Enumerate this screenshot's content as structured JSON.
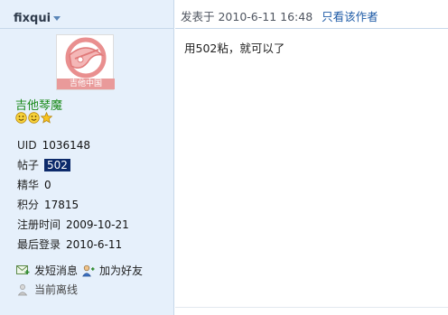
{
  "author": {
    "name": "fixqui",
    "avatar_caption": "吉他中国",
    "rank_title": "吉他琴魔",
    "badges": [
      "smile-icon",
      "smile-icon",
      "star-icon"
    ],
    "stats": [
      {
        "key": "UID",
        "value": "1036148"
      },
      {
        "key": "帖子",
        "value": "502"
      },
      {
        "key": "精华",
        "value": "0"
      },
      {
        "key": "积分",
        "value": "17815"
      },
      {
        "key": "注册时间",
        "value": "2009-10-21"
      },
      {
        "key": "最后登录",
        "value": "2010-6-11"
      }
    ],
    "actions": {
      "message": "发短消息",
      "add_friend": "加为好友",
      "status": "当前离线"
    }
  },
  "post": {
    "posted_label": "发表于 2010-6-11 16:48",
    "only_author": "只看该作者",
    "content": "用502粘，就可以了"
  },
  "colors": {
    "sidebar_bg": "#e6f0fb",
    "rank_green": "#1a8a1a",
    "highlight": "#0d2a6b",
    "link_blue": "#1d5aa6"
  }
}
